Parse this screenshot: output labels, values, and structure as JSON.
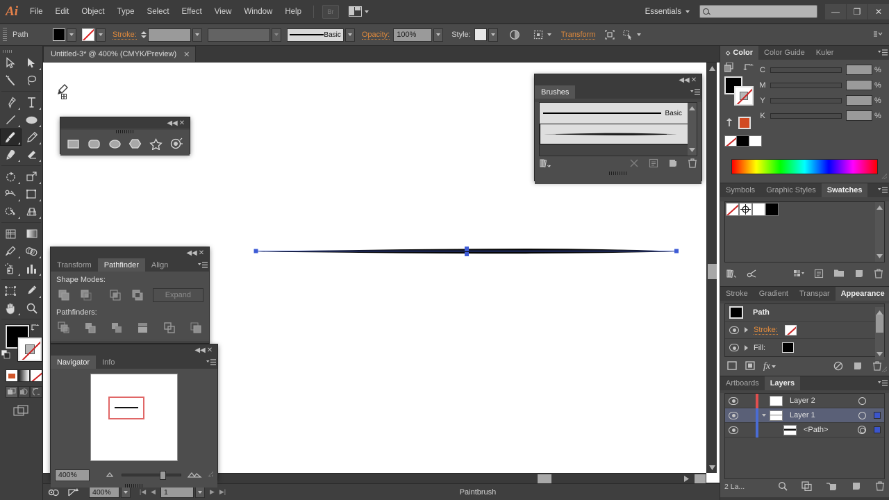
{
  "app": {
    "name": "Adobe Illustrator",
    "logo": "Ai",
    "menus": [
      "File",
      "Edit",
      "Object",
      "Type",
      "Select",
      "Effect",
      "View",
      "Window",
      "Help"
    ],
    "bridge_label": "Br",
    "workspace": "Essentials",
    "search_placeholder": "",
    "window_buttons": {
      "minimize": "—",
      "maximize": "❐",
      "close": "✕"
    }
  },
  "control_bar": {
    "selection_label": "Path",
    "fill_label": "fill-swatch",
    "stroke_swatch_label": "stroke-none-swatch",
    "stroke_label": "Stroke:",
    "stroke_weight": "",
    "stroke_profile": "",
    "brush_name": "Basic",
    "opacity_label": "Opacity:",
    "opacity_value": "100%",
    "style_label": "Style:",
    "transform_label": "Transform"
  },
  "toolbar": {
    "tools": [
      "selection-tool",
      "direct-selection-tool",
      "magic-wand-tool",
      "lasso-tool",
      "pen-tool",
      "type-tool",
      "line-segment-tool",
      "ellipse-tool",
      "paintbrush-tool",
      "pencil-tool",
      "blob-brush-tool",
      "eraser-tool",
      "rotate-tool",
      "scale-tool",
      "width-tool",
      "free-transform-tool",
      "shape-builder-tool",
      "perspective-grid-tool",
      "mesh-tool",
      "gradient-tool",
      "eyedropper-tool",
      "blend-tool",
      "symbol-sprayer-tool",
      "column-graph-tool",
      "artboard-tool",
      "slice-tool",
      "hand-tool",
      "zoom-tool"
    ],
    "active_tool": "paintbrush-tool",
    "fill_color": "#000000",
    "stroke_color": "none",
    "color_modes": [
      "color",
      "gradient",
      "none"
    ],
    "draw_modes": [
      "draw-normal",
      "draw-behind",
      "draw-inside"
    ],
    "screen_mode": "screen-mode-toggle"
  },
  "document": {
    "tab_title": "Untitled-3* @ 400% (CMYK/Preview)",
    "close_label": "✕",
    "artwork_name": "tapered-brush-stroke"
  },
  "status_bar": {
    "zoom": "400%",
    "artboard_number": "1",
    "current_tool": "Paintbrush"
  },
  "shapes_panel": {
    "name": "shape-tools-palette",
    "shapes": [
      "rectangle-tool",
      "rounded-rectangle-tool",
      "ellipse-tool",
      "polygon-tool",
      "star-tool",
      "flare-tool"
    ]
  },
  "brushes_panel": {
    "tab": "Brushes",
    "items": [
      {
        "name": "Basic",
        "type": "calligraphic"
      },
      {
        "name": "",
        "type": "art-tapered",
        "selected": true
      }
    ],
    "footer_icons": [
      "brush-libraries-icon",
      "libraries-panel-icon",
      "remove-brush-link-icon",
      "options-icon",
      "new-brush-icon",
      "delete-brush-icon"
    ]
  },
  "pathfinder_panel": {
    "tabs": [
      "Transform",
      "Pathfinder",
      "Align"
    ],
    "active_tab": "Pathfinder",
    "shape_modes_label": "Shape Modes:",
    "pathfinders_label": "Pathfinders:",
    "expand_label": "Expand",
    "shape_modes": [
      "unite",
      "minus-front",
      "intersect",
      "exclude"
    ],
    "pathfinders": [
      "divide",
      "trim",
      "merge",
      "crop",
      "outline",
      "minus-back"
    ]
  },
  "navigator_panel": {
    "tabs": [
      "Navigator",
      "Info"
    ],
    "active_tab": "Navigator",
    "zoom_value": "400%",
    "view_box_color": "#e06666"
  },
  "color_panel": {
    "tabs": [
      "Color",
      "Color Guide",
      "Kuler"
    ],
    "active_tab": "Color",
    "channels": [
      {
        "label": "C",
        "value": "",
        "unit": "%"
      },
      {
        "label": "M",
        "value": "",
        "unit": "%"
      },
      {
        "label": "Y",
        "value": "",
        "unit": "%"
      },
      {
        "label": "K",
        "value": "",
        "unit": "%"
      }
    ],
    "fill_color": "#000000",
    "stroke_color": "none",
    "accent_swatch": "#d14a22"
  },
  "swatches_panel": {
    "tabs": [
      "Symbols",
      "Graphic Styles",
      "Swatches"
    ],
    "active_tab": "Swatches",
    "swatches": [
      "none",
      "registration",
      "#ffffff",
      "#000000"
    ],
    "footer_icons": [
      "swatch-libraries-icon",
      "color-link-icon",
      "show-kinds-icon",
      "options-icon",
      "new-group-icon",
      "new-swatch-icon",
      "delete-swatch-icon"
    ]
  },
  "appearance_panel": {
    "tabs": [
      "Stroke",
      "Gradient",
      "Transpar",
      "Appearance"
    ],
    "active_tab": "Appearance",
    "target_label": "Path",
    "rows": [
      {
        "label": "Stroke:",
        "swatch": "none",
        "accent": true
      },
      {
        "label": "Fill:",
        "swatch": "#000000",
        "accent": false
      }
    ],
    "footer_icons": [
      "add-new-stroke-icon",
      "add-new-fill-icon",
      "add-effect-icon",
      "clear-appearance-icon",
      "duplicate-item-icon",
      "delete-item-icon"
    ]
  },
  "layers_panel": {
    "tabs": [
      "Artboards",
      "Layers"
    ],
    "active_tab": "Layers",
    "layers": [
      {
        "name": "Layer 2",
        "color": "#e04f4f",
        "visible": true,
        "expanded": false,
        "selected": false,
        "indent": 0,
        "targeted": false
      },
      {
        "name": "Layer 1",
        "color": "#4a6cd4",
        "visible": true,
        "expanded": true,
        "selected": true,
        "indent": 0,
        "targeted": false
      },
      {
        "name": "<Path>",
        "color": "#4a6cd4",
        "visible": true,
        "expanded": false,
        "selected": false,
        "indent": 1,
        "targeted": true
      }
    ],
    "count_label": "2 La...",
    "footer_icons": [
      "locate-object-icon",
      "make-clipping-mask-icon",
      "create-new-sublayer-icon",
      "create-new-layer-icon",
      "delete-selection-icon"
    ]
  }
}
